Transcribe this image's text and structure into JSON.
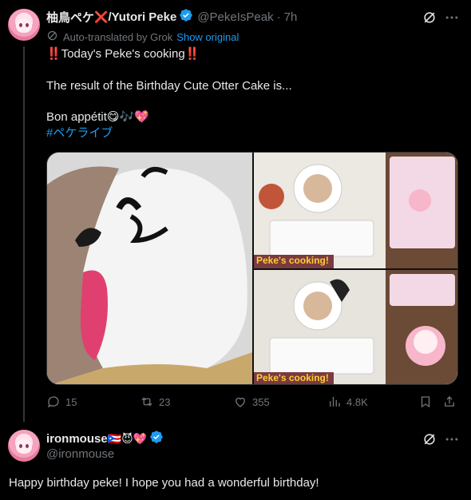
{
  "post": {
    "author_name": "柚鳥ペケ",
    "cross_emoji": "❌",
    "author_name_suffix": "/Yutori Peke",
    "handle": "@PekeIsPeak",
    "time_sep": "·",
    "time": "7h",
    "translation": {
      "label": "Auto-translated by Grok",
      "show_original": "Show original"
    },
    "lines": {
      "line1_prefix": "‼️",
      "line1_text": "Today's Peke's cooking",
      "line1_suffix": "‼️",
      "line2": "The result of the Birthday Cute Otter Cake is...",
      "line3_text": "Bon appétit",
      "line3_emojis": "😋🎶💖",
      "hashtag": "#ペケライブ"
    },
    "media": {
      "overlay_label_top": "Peke's cooking!",
      "overlay_label_bottom": "Peke's cooking!"
    },
    "stats": {
      "replies": "15",
      "reposts": "23",
      "likes": "355",
      "views": "4.8K"
    }
  },
  "reply": {
    "author_name": "ironmouse",
    "author_emojis": "🇵🇷😈💖",
    "handle": "@ironmouse",
    "text": "Happy birthday peke! I hope you had a wonderful birthday!"
  },
  "colors": {
    "accent": "#1d9bf0",
    "muted": "#71767b",
    "background": "#000000"
  }
}
